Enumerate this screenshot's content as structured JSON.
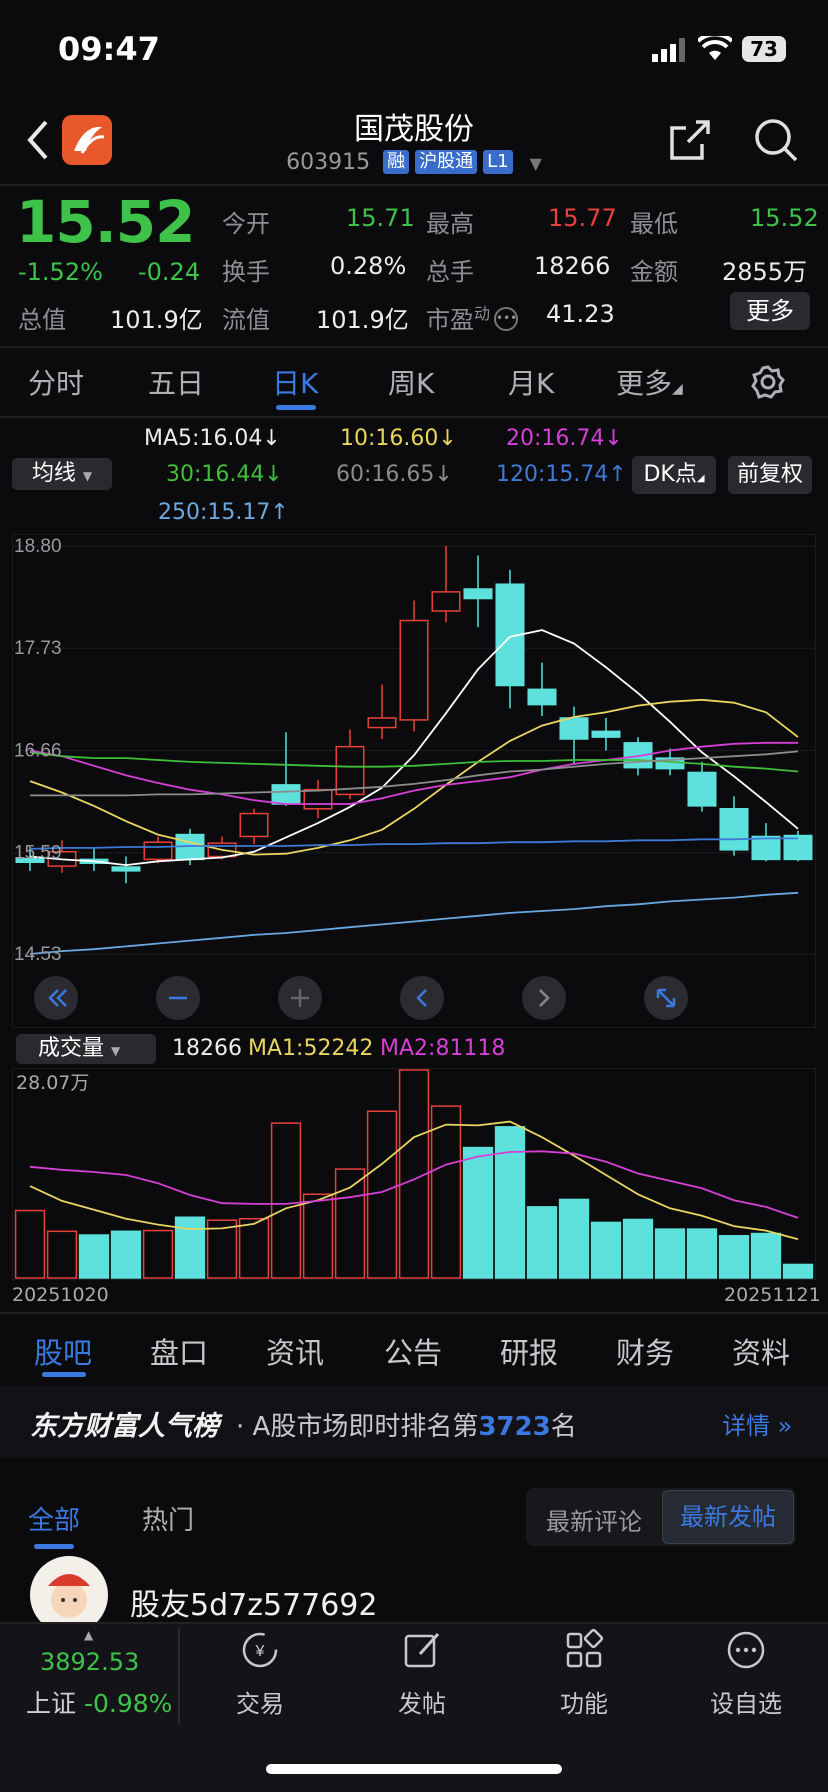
{
  "status": {
    "time": "09:47",
    "battery": "73"
  },
  "header": {
    "title": "国茂股份",
    "code": "603915",
    "tags": [
      "融",
      "沪股通",
      "L1"
    ]
  },
  "quote": {
    "price": "15.52",
    "change_pct": "-1.52%",
    "change": "-0.24",
    "open_label": "今开",
    "open": "15.71",
    "high_label": "最高",
    "high": "15.77",
    "low_label": "最低",
    "low": "15.52",
    "turnover_label": "换手",
    "turnover": "0.28%",
    "volume_label": "总手",
    "volume": "18266",
    "amount_label": "金额",
    "amount": "2855万",
    "mktcap_label": "总值",
    "mktcap": "101.9亿",
    "float_label": "流值",
    "float_cap": "101.9亿",
    "pe_label": "市盈",
    "pe_sup": "动",
    "pe": "41.23",
    "more_btn": "更多"
  },
  "tabs": [
    "分时",
    "五日",
    "日K",
    "周K",
    "月K",
    "更多"
  ],
  "ma_legend": {
    "selector": "均线",
    "ma5": "MA5:16.04",
    "ma10": "10:16.60",
    "ma20": "20:16.74",
    "ma30": "30:16.44",
    "ma60": "60:16.65",
    "ma120": "120:15.74",
    "ma250": "250:15.17",
    "dk_btn": "DK点",
    "fq_btn": "前复权"
  },
  "colors": {
    "up": "#e8413b",
    "down": "#5ee0dc",
    "ma5": "#ffffff",
    "ma10": "#e8d660",
    "ma20": "#d640d6",
    "ma30": "#3fbf3a",
    "ma60": "#8c8c8c",
    "ma120": "#3e7ad6",
    "ma250": "#6aa8e0",
    "accent": "#3a7ae0"
  },
  "chart_data": [
    {
      "type": "candlestick",
      "y_ticks": [
        "18.80",
        "17.73",
        "16.66",
        "15.59",
        "14.53"
      ],
      "ylim": [
        14.53,
        18.8
      ],
      "candles": [
        {
          "o": 15.53,
          "c": 15.49,
          "h": 15.65,
          "l": 15.4
        },
        {
          "o": 15.45,
          "c": 15.6,
          "h": 15.72,
          "l": 15.38
        },
        {
          "o": 15.52,
          "c": 15.48,
          "h": 15.65,
          "l": 15.4
        },
        {
          "o": 15.44,
          "c": 15.4,
          "h": 15.55,
          "l": 15.27
        },
        {
          "o": 15.52,
          "c": 15.7,
          "h": 15.76,
          "l": 15.48
        },
        {
          "o": 15.78,
          "c": 15.52,
          "h": 15.84,
          "l": 15.46
        },
        {
          "o": 15.55,
          "c": 15.69,
          "h": 15.76,
          "l": 15.52
        },
        {
          "o": 15.76,
          "c": 16.0,
          "h": 16.05,
          "l": 15.68
        },
        {
          "o": 16.3,
          "c": 16.1,
          "h": 16.85,
          "l": 16.08
        },
        {
          "o": 16.05,
          "c": 16.25,
          "h": 16.35,
          "l": 15.95
        },
        {
          "o": 16.2,
          "c": 16.7,
          "h": 16.88,
          "l": 16.15
        },
        {
          "o": 16.9,
          "c": 17.0,
          "h": 17.35,
          "l": 16.78
        },
        {
          "o": 16.98,
          "c": 18.02,
          "h": 18.23,
          "l": 16.86
        },
        {
          "o": 18.12,
          "c": 18.32,
          "h": 18.8,
          "l": 18.0
        },
        {
          "o": 18.35,
          "c": 18.25,
          "h": 18.7,
          "l": 17.95
        },
        {
          "o": 18.4,
          "c": 17.34,
          "h": 18.55,
          "l": 17.1
        },
        {
          "o": 17.3,
          "c": 17.14,
          "h": 17.58,
          "l": 17.02
        },
        {
          "o": 17.0,
          "c": 16.78,
          "h": 17.12,
          "l": 16.52
        },
        {
          "o": 16.86,
          "c": 16.8,
          "h": 17.0,
          "l": 16.66
        },
        {
          "o": 16.74,
          "c": 16.48,
          "h": 16.8,
          "l": 16.4
        },
        {
          "o": 16.58,
          "c": 16.47,
          "h": 16.68,
          "l": 16.4
        },
        {
          "o": 16.43,
          "c": 16.08,
          "h": 16.54,
          "l": 16.02
        },
        {
          "o": 16.05,
          "c": 15.62,
          "h": 16.18,
          "l": 15.56
        },
        {
          "o": 15.76,
          "c": 15.52,
          "h": 15.9,
          "l": 15.5
        },
        {
          "o": 15.77,
          "c": 15.52,
          "h": 15.82,
          "l": 15.5
        }
      ],
      "series": [
        {
          "name": "MA5",
          "values": [
            15.55,
            15.52,
            15.5,
            15.46,
            15.5,
            15.52,
            15.54,
            15.6,
            15.75,
            15.9,
            16.07,
            16.27,
            16.61,
            17.05,
            17.51,
            17.85,
            17.92,
            17.78,
            17.53,
            17.26,
            16.96,
            16.64,
            16.39,
            16.12,
            15.84
          ]
        },
        {
          "name": "MA10",
          "values": [
            16.34,
            16.22,
            16.08,
            15.92,
            15.78,
            15.7,
            15.62,
            15.57,
            15.58,
            15.64,
            15.72,
            15.83,
            16.05,
            16.3,
            16.54,
            16.76,
            16.92,
            17.01,
            17.06,
            17.13,
            17.17,
            17.19,
            17.16,
            17.06,
            16.8
          ]
        },
        {
          "name": "MA20",
          "values": [
            16.66,
            16.6,
            16.5,
            16.4,
            16.32,
            16.25,
            16.2,
            16.14,
            16.1,
            16.1,
            16.1,
            16.16,
            16.24,
            16.3,
            16.34,
            16.38,
            16.46,
            16.52,
            16.56,
            16.6,
            16.66,
            16.7,
            16.73,
            16.74,
            16.74
          ]
        },
        {
          "name": "MA30",
          "values": [
            16.64,
            16.6,
            16.58,
            16.58,
            16.56,
            16.54,
            16.53,
            16.52,
            16.51,
            16.5,
            16.49,
            16.49,
            16.5,
            16.52,
            16.54,
            16.55,
            16.55,
            16.56,
            16.56,
            16.56,
            16.54,
            16.52,
            16.49,
            16.47,
            16.44
          ]
        },
        {
          "name": "MA60",
          "values": [
            16.19,
            16.19,
            16.19,
            16.19,
            16.2,
            16.2,
            16.21,
            16.22,
            16.23,
            16.24,
            16.26,
            16.28,
            16.31,
            16.35,
            16.4,
            16.44,
            16.46,
            16.49,
            16.52,
            16.54,
            16.56,
            16.58,
            16.6,
            16.62,
            16.65
          ]
        },
        {
          "name": "MA120",
          "values": [
            15.63,
            15.64,
            15.64,
            15.65,
            15.65,
            15.66,
            15.66,
            15.66,
            15.66,
            15.67,
            15.67,
            15.68,
            15.68,
            15.69,
            15.69,
            15.7,
            15.7,
            15.71,
            15.71,
            15.72,
            15.72,
            15.73,
            15.73,
            15.74,
            15.74
          ]
        },
        {
          "name": "MA250",
          "values": [
            14.53,
            14.56,
            14.58,
            14.61,
            14.64,
            14.67,
            14.7,
            14.73,
            14.75,
            14.78,
            14.81,
            14.84,
            14.87,
            14.9,
            14.93,
            14.96,
            14.98,
            15.0,
            15.03,
            15.05,
            15.08,
            15.1,
            15.12,
            15.15,
            15.17
          ]
        }
      ]
    },
    {
      "type": "bar",
      "label": "成交量",
      "selector": "成交量",
      "current": "18266",
      "ma1": "MA1:52242",
      "ma2": "MA2:81118",
      "y_tick": "28.07万",
      "ylim": [
        0,
        280700
      ],
      "x_start": "20251020",
      "x_end": "20251121",
      "volumes": [
        91000,
        63000,
        58000,
        63000,
        64000,
        82000,
        78000,
        80000,
        209000,
        113000,
        147000,
        225000,
        280700,
        232000,
        176000,
        204000,
        96000,
        106000,
        75000,
        79000,
        66000,
        66000,
        57000,
        60000,
        18266
      ],
      "up": [
        true,
        true,
        false,
        false,
        true,
        false,
        true,
        true,
        true,
        true,
        true,
        true,
        true,
        true,
        false,
        false,
        false,
        false,
        false,
        false,
        false,
        false,
        false,
        false,
        false
      ],
      "series": [
        {
          "name": "MA1",
          "values": [
            124000,
            104000,
            92000,
            80000,
            72000,
            66000,
            67000,
            73000,
            94000,
            105000,
            122000,
            154000,
            190000,
            207000,
            206000,
            211000,
            190000,
            165000,
            139000,
            113000,
            94000,
            84000,
            70000,
            64000,
            52242
          ]
        },
        {
          "name": "MA2",
          "values": [
            150000,
            146000,
            143000,
            139000,
            128000,
            112000,
            101000,
            100000,
            100000,
            104000,
            109000,
            116000,
            133000,
            153000,
            164000,
            170000,
            171000,
            168000,
            157000,
            141000,
            131000,
            121000,
            105000,
            96000,
            81118
          ]
        }
      ]
    }
  ],
  "sub_tabs": [
    "股吧",
    "盘口",
    "资讯",
    "公告",
    "研报",
    "财务",
    "资料"
  ],
  "rank": {
    "brand": "东方财富人气榜",
    "text_prefix": "A股市场即时排名第",
    "rank": "3723",
    "text_suffix": "名",
    "detail": "详情"
  },
  "feed": {
    "tab_all": "全部",
    "tab_hot": "热门",
    "btn_comment": "最新评论",
    "btn_post": "最新发帖",
    "post_user": "股友5d7z577692"
  },
  "bottom_nav": {
    "index_value": "3892.53",
    "index_name": "上证",
    "index_change": "-0.98%",
    "items": [
      "交易",
      "发帖",
      "功能",
      "设自选"
    ]
  }
}
